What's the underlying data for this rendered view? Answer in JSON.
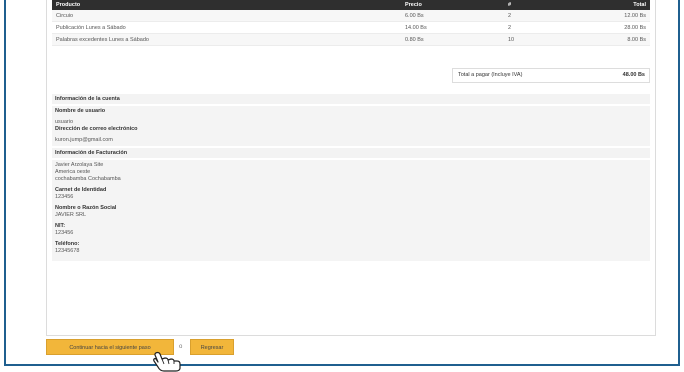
{
  "order_table": {
    "headers": [
      "Producto",
      "Precio",
      "#",
      "Total"
    ],
    "rows": [
      [
        "Circuio",
        "6.00 Bs",
        "2",
        "12.00 Bs"
      ],
      [
        "Publicación Lunes a Sábado",
        "14.00 Bs",
        "2",
        "28.00 Bs"
      ],
      [
        "Palabras excedentes Lunes a Sábado",
        "0.80 Bs",
        "10",
        "8.00 Bs"
      ]
    ]
  },
  "summary": {
    "label": "Total a pagar (Incluye IVA)",
    "value": "48.00 Bs"
  },
  "account": {
    "section_title": "Información de la cuenta",
    "username_label": "Nombre de usuario",
    "username_value": "usuario",
    "email_label": "Dirección de correo electrónico",
    "email_value": "kuron.jump@gmail.com"
  },
  "billing": {
    "section_title": "Información de Facturación",
    "address_lines": [
      "Javier Arzolaya Site",
      "America oeste",
      "cochabamba Cochabamba"
    ],
    "id_label": "Carnet de Identidad",
    "id_value": "123456",
    "name_label": "Nombre o Razón Social",
    "name_value": "JAVIER SRL",
    "nit_label": "NIT:",
    "nit_value": "123456",
    "phone_label": "Teléfono:",
    "phone_value": "12345678"
  },
  "actions": {
    "continue_label": "Continuar hacia el siguiente paso",
    "separator": "o",
    "back_label": "Regresar"
  }
}
